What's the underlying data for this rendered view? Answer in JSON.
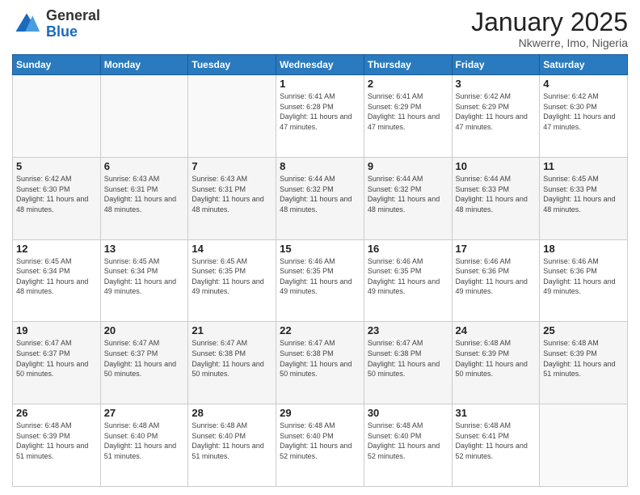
{
  "logo": {
    "general": "General",
    "blue": "Blue"
  },
  "header": {
    "month": "January 2025",
    "location": "Nkwerre, Imo, Nigeria"
  },
  "days_of_week": [
    "Sunday",
    "Monday",
    "Tuesday",
    "Wednesday",
    "Thursday",
    "Friday",
    "Saturday"
  ],
  "weeks": [
    [
      {
        "day": "",
        "info": ""
      },
      {
        "day": "",
        "info": ""
      },
      {
        "day": "",
        "info": ""
      },
      {
        "day": "1",
        "info": "Sunrise: 6:41 AM\nSunset: 6:28 PM\nDaylight: 11 hours and 47 minutes."
      },
      {
        "day": "2",
        "info": "Sunrise: 6:41 AM\nSunset: 6:29 PM\nDaylight: 11 hours and 47 minutes."
      },
      {
        "day": "3",
        "info": "Sunrise: 6:42 AM\nSunset: 6:29 PM\nDaylight: 11 hours and 47 minutes."
      },
      {
        "day": "4",
        "info": "Sunrise: 6:42 AM\nSunset: 6:30 PM\nDaylight: 11 hours and 47 minutes."
      }
    ],
    [
      {
        "day": "5",
        "info": "Sunrise: 6:42 AM\nSunset: 6:30 PM\nDaylight: 11 hours and 48 minutes."
      },
      {
        "day": "6",
        "info": "Sunrise: 6:43 AM\nSunset: 6:31 PM\nDaylight: 11 hours and 48 minutes."
      },
      {
        "day": "7",
        "info": "Sunrise: 6:43 AM\nSunset: 6:31 PM\nDaylight: 11 hours and 48 minutes."
      },
      {
        "day": "8",
        "info": "Sunrise: 6:44 AM\nSunset: 6:32 PM\nDaylight: 11 hours and 48 minutes."
      },
      {
        "day": "9",
        "info": "Sunrise: 6:44 AM\nSunset: 6:32 PM\nDaylight: 11 hours and 48 minutes."
      },
      {
        "day": "10",
        "info": "Sunrise: 6:44 AM\nSunset: 6:33 PM\nDaylight: 11 hours and 48 minutes."
      },
      {
        "day": "11",
        "info": "Sunrise: 6:45 AM\nSunset: 6:33 PM\nDaylight: 11 hours and 48 minutes."
      }
    ],
    [
      {
        "day": "12",
        "info": "Sunrise: 6:45 AM\nSunset: 6:34 PM\nDaylight: 11 hours and 48 minutes."
      },
      {
        "day": "13",
        "info": "Sunrise: 6:45 AM\nSunset: 6:34 PM\nDaylight: 11 hours and 49 minutes."
      },
      {
        "day": "14",
        "info": "Sunrise: 6:45 AM\nSunset: 6:35 PM\nDaylight: 11 hours and 49 minutes."
      },
      {
        "day": "15",
        "info": "Sunrise: 6:46 AM\nSunset: 6:35 PM\nDaylight: 11 hours and 49 minutes."
      },
      {
        "day": "16",
        "info": "Sunrise: 6:46 AM\nSunset: 6:35 PM\nDaylight: 11 hours and 49 minutes."
      },
      {
        "day": "17",
        "info": "Sunrise: 6:46 AM\nSunset: 6:36 PM\nDaylight: 11 hours and 49 minutes."
      },
      {
        "day": "18",
        "info": "Sunrise: 6:46 AM\nSunset: 6:36 PM\nDaylight: 11 hours and 49 minutes."
      }
    ],
    [
      {
        "day": "19",
        "info": "Sunrise: 6:47 AM\nSunset: 6:37 PM\nDaylight: 11 hours and 50 minutes."
      },
      {
        "day": "20",
        "info": "Sunrise: 6:47 AM\nSunset: 6:37 PM\nDaylight: 11 hours and 50 minutes."
      },
      {
        "day": "21",
        "info": "Sunrise: 6:47 AM\nSunset: 6:38 PM\nDaylight: 11 hours and 50 minutes."
      },
      {
        "day": "22",
        "info": "Sunrise: 6:47 AM\nSunset: 6:38 PM\nDaylight: 11 hours and 50 minutes."
      },
      {
        "day": "23",
        "info": "Sunrise: 6:47 AM\nSunset: 6:38 PM\nDaylight: 11 hours and 50 minutes."
      },
      {
        "day": "24",
        "info": "Sunrise: 6:48 AM\nSunset: 6:39 PM\nDaylight: 11 hours and 50 minutes."
      },
      {
        "day": "25",
        "info": "Sunrise: 6:48 AM\nSunset: 6:39 PM\nDaylight: 11 hours and 51 minutes."
      }
    ],
    [
      {
        "day": "26",
        "info": "Sunrise: 6:48 AM\nSunset: 6:39 PM\nDaylight: 11 hours and 51 minutes."
      },
      {
        "day": "27",
        "info": "Sunrise: 6:48 AM\nSunset: 6:40 PM\nDaylight: 11 hours and 51 minutes."
      },
      {
        "day": "28",
        "info": "Sunrise: 6:48 AM\nSunset: 6:40 PM\nDaylight: 11 hours and 51 minutes."
      },
      {
        "day": "29",
        "info": "Sunrise: 6:48 AM\nSunset: 6:40 PM\nDaylight: 11 hours and 52 minutes."
      },
      {
        "day": "30",
        "info": "Sunrise: 6:48 AM\nSunset: 6:40 PM\nDaylight: 11 hours and 52 minutes."
      },
      {
        "day": "31",
        "info": "Sunrise: 6:48 AM\nSunset: 6:41 PM\nDaylight: 11 hours and 52 minutes."
      },
      {
        "day": "",
        "info": ""
      }
    ]
  ]
}
